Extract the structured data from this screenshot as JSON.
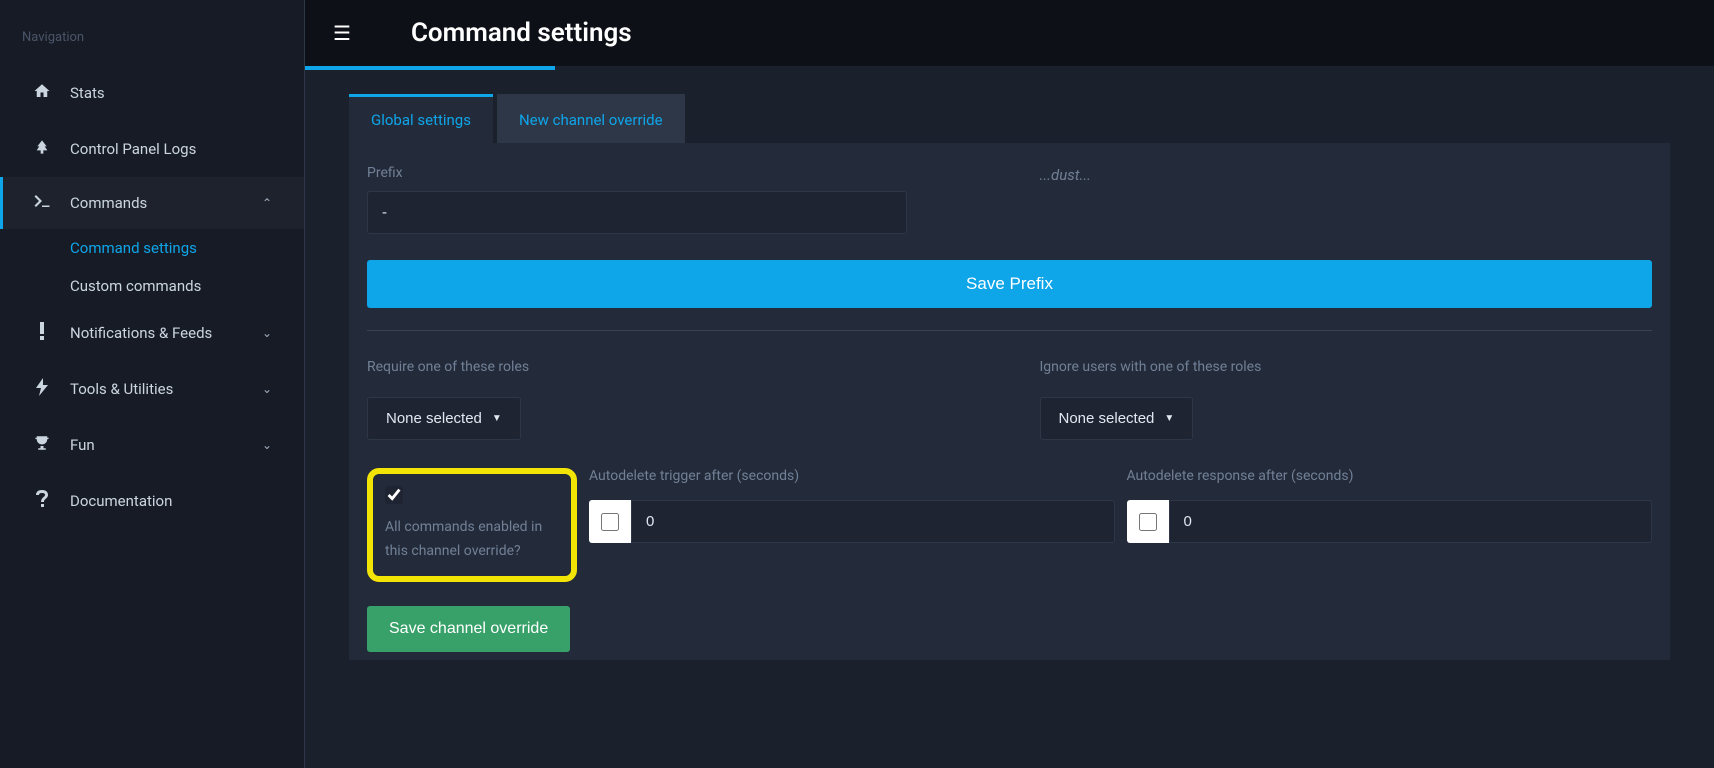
{
  "sidebar": {
    "header": "Navigation",
    "items": [
      {
        "label": "Stats",
        "icon": "home"
      },
      {
        "label": "Control Panel Logs",
        "icon": "tree"
      },
      {
        "label": "Commands",
        "icon": "terminal",
        "expanded": true
      },
      {
        "label": "Notifications & Feeds",
        "icon": "exclaim"
      },
      {
        "label": "Tools & Utilities",
        "icon": "bolt"
      },
      {
        "label": "Fun",
        "icon": "trophy"
      },
      {
        "label": "Documentation",
        "icon": "question"
      }
    ],
    "sub": [
      {
        "label": "Command settings",
        "active": true
      },
      {
        "label": "Custom commands",
        "active": false
      }
    ]
  },
  "header": {
    "title": "Command settings"
  },
  "tabs": [
    {
      "label": "Global settings",
      "active": true
    },
    {
      "label": "New channel override",
      "active": false
    }
  ],
  "form": {
    "prefix_label": "Prefix",
    "prefix_value": "-",
    "dust_text": "...dust...",
    "save_prefix": "Save Prefix",
    "require_roles_label": "Require one of these roles",
    "ignore_roles_label": "Ignore users with one of these roles",
    "none_selected": "None selected",
    "all_commands_label": "All commands enabled in this channel override?",
    "all_commands_checked": true,
    "autodelete_trigger_label": "Autodelete trigger after (seconds)",
    "autodelete_response_label": "Autodelete response after (seconds)",
    "autodelete_trigger_value": "0",
    "autodelete_trigger_checked": false,
    "autodelete_response_value": "0",
    "autodelete_response_checked": false,
    "save_override": "Save channel override"
  }
}
